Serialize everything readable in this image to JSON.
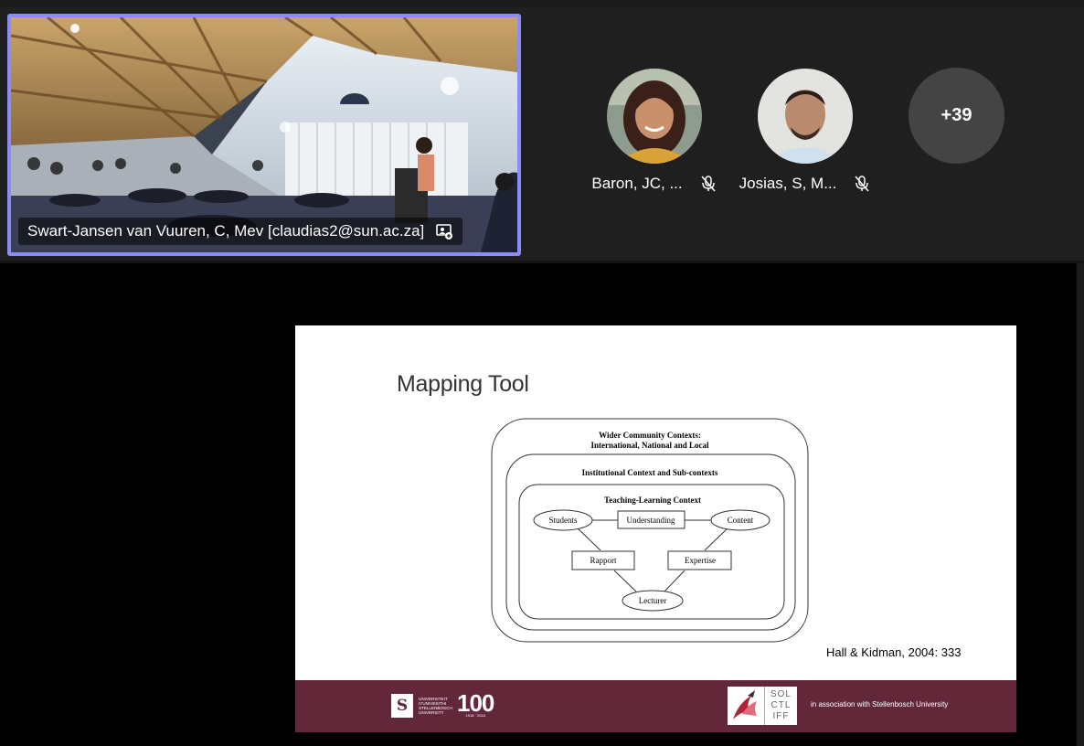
{
  "featured": {
    "name": "Swart-Jansen van Vuuren, C, Mev [claudias2@sun.ac.za]",
    "icon": "screen-share-icon"
  },
  "participants": [
    {
      "name": "Baron, JC, ...",
      "mic": "mic-off-icon"
    },
    {
      "name": "Josias, S, M...",
      "mic": "mic-off-icon"
    }
  ],
  "more_participants": "+39",
  "slide": {
    "title": "Mapping Tool",
    "diagram": {
      "outer": [
        "Wider Community Contexts:",
        "International, National and Local"
      ],
      "middle": "Institutional Context and Sub-contexts",
      "inner": "Teaching-Learning Context",
      "nodes": {
        "students": "Students",
        "understanding": "Understanding",
        "content": "Content",
        "rapport": "Rapport",
        "expertise": "Expertise",
        "lecturer": "Lecturer"
      }
    },
    "citation": "Hall & Kidman, 2004: 333",
    "footer": {
      "uni_mark": "S",
      "uni_name": "UNIVERSITEIT IYUNIVESITHI STELLENBOSCH UNIVERSITY",
      "uni_100": "100",
      "uni_years": "1918 · 2018",
      "sol_lines": [
        "SOL",
        "CTL",
        "IFF"
      ],
      "association": "in association with Stellenbosch University"
    }
  },
  "colors": {
    "tile_border": "#8b8cf5",
    "gallery_bg": "#1f1f1f",
    "footer_bg": "#62283a",
    "more_bg": "#444444"
  }
}
